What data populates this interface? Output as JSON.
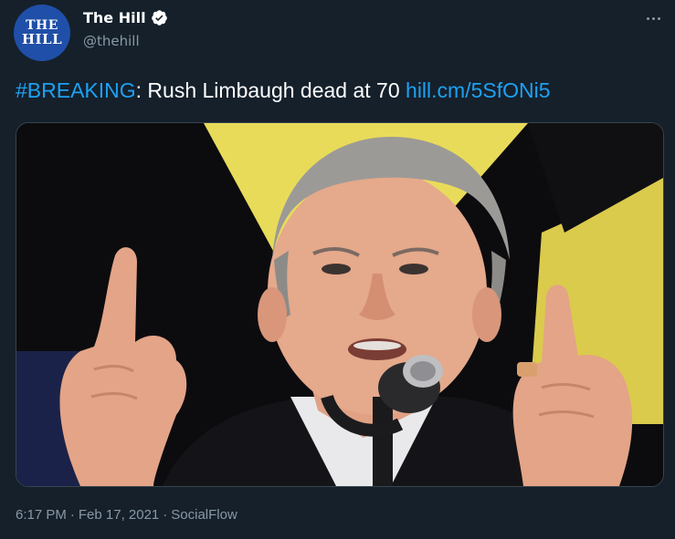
{
  "account": {
    "avatar_line1": "THE",
    "avatar_line2": "HILL",
    "display_name": "The Hill",
    "handle": "@thehill",
    "verified": true
  },
  "tweet": {
    "hashtag": "#BREAKING",
    "text": ": Rush Limbaugh dead at 70 ",
    "link": "hill.cm/5SfONi5"
  },
  "meta": {
    "time": "6:17 PM",
    "separator": "·",
    "date": "Feb 17, 2021",
    "source": "SocialFlow"
  },
  "colors": {
    "background": "#15202b",
    "accent": "#1da1f2",
    "muted": "#8899a6",
    "avatar": "#1f4fa8"
  },
  "icons": {
    "verified": "verified-badge-icon",
    "more": "more-options-icon"
  }
}
